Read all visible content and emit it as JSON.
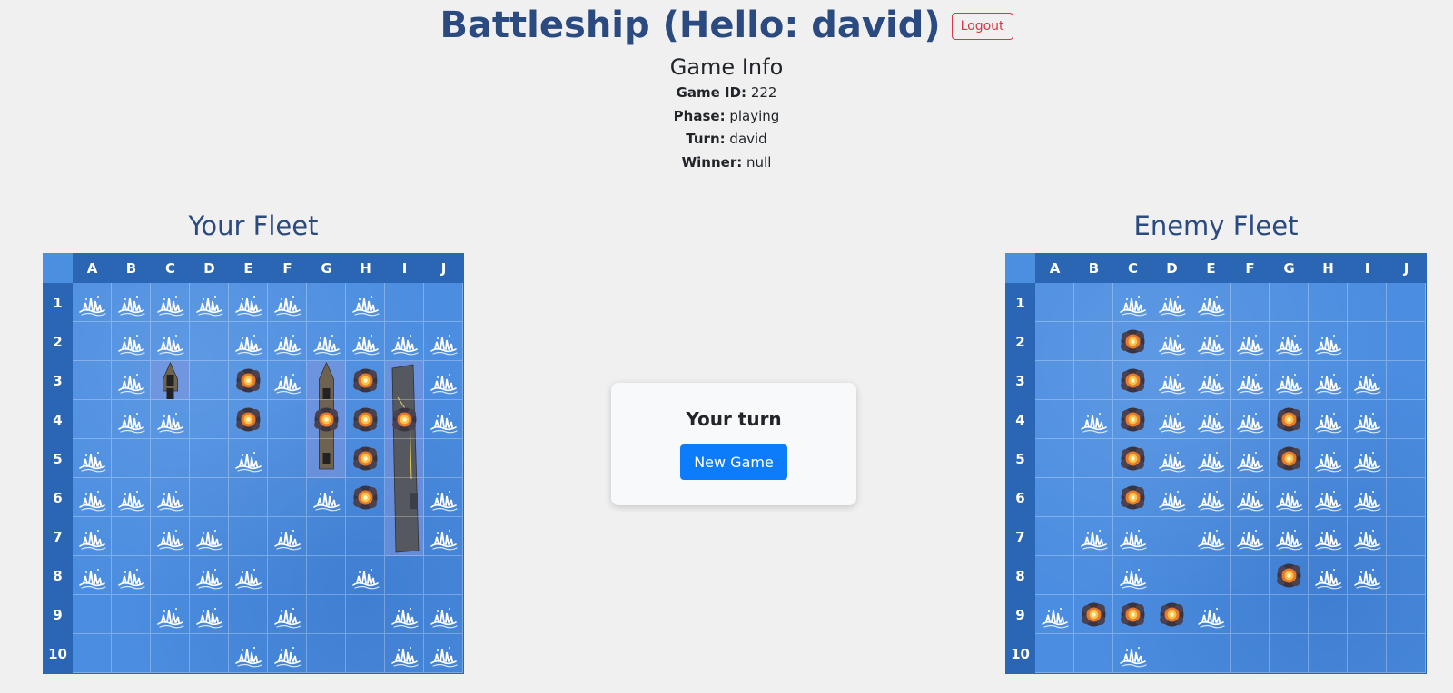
{
  "header": {
    "title": "Battleship (Hello: david)",
    "logout_label": "Logout"
  },
  "game_info": {
    "title": "Game Info",
    "game_id_label": "Game ID:",
    "game_id": "222",
    "phase_label": "Phase:",
    "phase": "playing",
    "turn_label": "Turn:",
    "turn": "david",
    "winner_label": "Winner:",
    "winner": "null"
  },
  "columns": [
    "A",
    "B",
    "C",
    "D",
    "E",
    "F",
    "G",
    "H",
    "I",
    "J"
  ],
  "rows": [
    "1",
    "2",
    "3",
    "4",
    "5",
    "6",
    "7",
    "8",
    "9",
    "10"
  ],
  "your_fleet": {
    "title": "Your Fleet",
    "misses": [
      "A1",
      "B1",
      "C1",
      "D1",
      "E1",
      "F1",
      "H1",
      "B2",
      "C2",
      "E2",
      "F2",
      "G2",
      "H2",
      "I2",
      "J2",
      "B3",
      "F3",
      "J3",
      "B4",
      "C4",
      "J4",
      "A5",
      "E5",
      "A6",
      "B6",
      "C6",
      "G6",
      "J6",
      "A7",
      "C7",
      "D7",
      "F7",
      "J7",
      "A8",
      "B8",
      "D8",
      "E8",
      "H8",
      "C9",
      "D9",
      "F9",
      "I9",
      "J9",
      "E10",
      "F10",
      "I10",
      "J10"
    ],
    "hits": [
      "E3",
      "H3",
      "E4",
      "G4",
      "H4",
      "I4",
      "H5",
      "H6"
    ],
    "ships": [
      {
        "type": "patrol-boat",
        "cells": [
          "C3"
        ]
      },
      {
        "type": "battleship",
        "cells": [
          "G3",
          "G4",
          "G5"
        ]
      },
      {
        "type": "carrier",
        "cells": [
          "I3",
          "I4",
          "I5",
          "I6",
          "I7"
        ]
      }
    ]
  },
  "enemy_fleet": {
    "title": "Enemy Fleet",
    "misses": [
      "C1",
      "D1",
      "E1",
      "D2",
      "E2",
      "F2",
      "G2",
      "H2",
      "D3",
      "E3",
      "F3",
      "G3",
      "H3",
      "I3",
      "B4",
      "D4",
      "E4",
      "F4",
      "H4",
      "I4",
      "D5",
      "E5",
      "F5",
      "H5",
      "I5",
      "D6",
      "E6",
      "F6",
      "G6",
      "H6",
      "I6",
      "B7",
      "C7",
      "E7",
      "F7",
      "G7",
      "H7",
      "I7",
      "C8",
      "H8",
      "I8",
      "A9",
      "E9",
      "C10"
    ],
    "hits": [
      "C2",
      "C3",
      "C4",
      "G4",
      "C5",
      "G5",
      "C6",
      "G8",
      "B9",
      "C9",
      "D9"
    ]
  },
  "status": {
    "text": "Your turn",
    "new_game_label": "New Game"
  },
  "colors": {
    "title": "#2a4a80",
    "board": "#2a66b4",
    "water": "#4b8de0",
    "logout": "#dc3545",
    "primary": "#0d7cfb"
  }
}
